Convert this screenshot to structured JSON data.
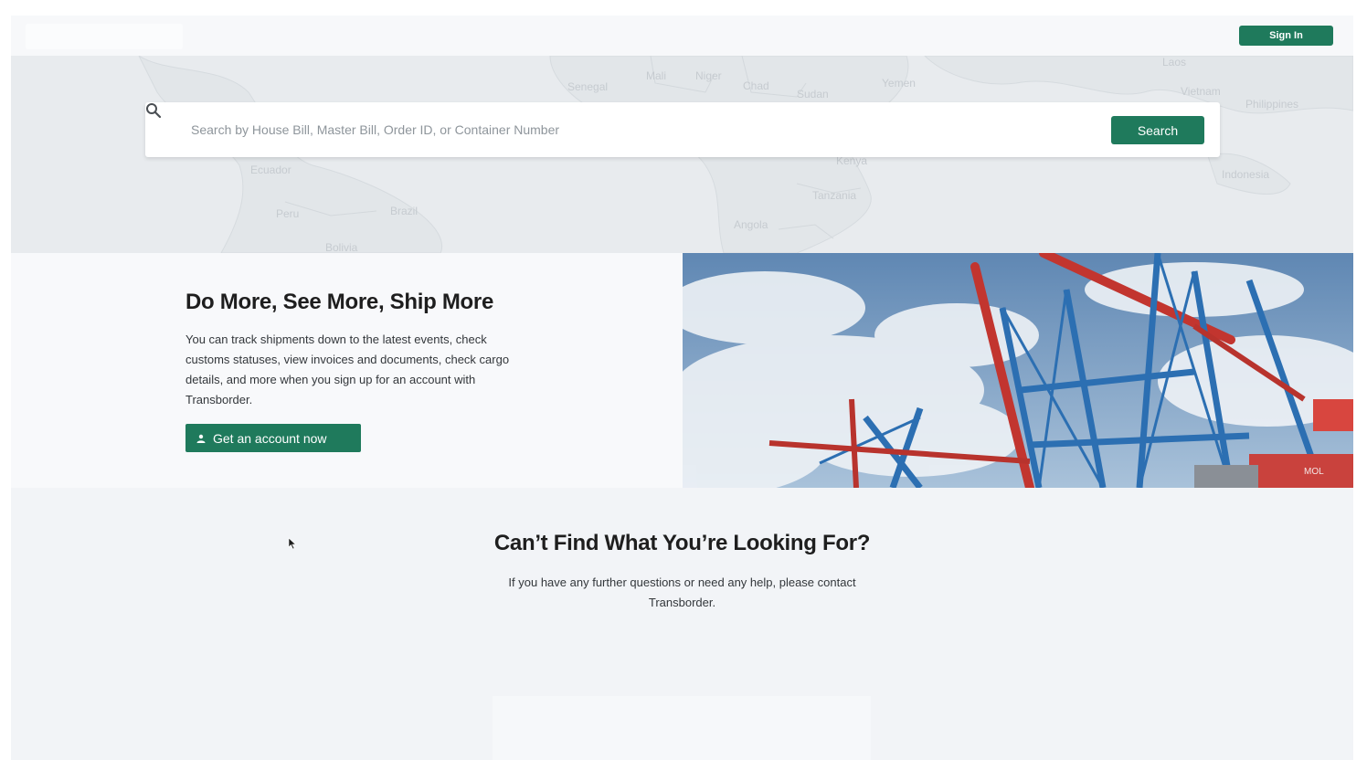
{
  "header": {
    "signin_label": "Sign In"
  },
  "map": {
    "labels": {
      "senegal": "Senegal",
      "mali": "Mali",
      "niger": "Niger",
      "chad": "Chad",
      "sudan": "Sudan",
      "yemen": "Yemen",
      "laos": "Laos",
      "vietnam": "Vietnam",
      "philippines": "Philippines",
      "ecuador": "Ecuador",
      "peru": "Peru",
      "brazil": "Brazil",
      "bolivia": "Bolivia",
      "kenya": "Kenya",
      "tanzania": "Tanzania",
      "angola": "Angola",
      "indonesia": "Indonesia"
    }
  },
  "search": {
    "placeholder": "Search by House Bill, Master Bill, Order ID, or Container Number",
    "button_label": "Search"
  },
  "promo": {
    "title": "Do More, See More, Ship More",
    "body": "You can track shipments down to the latest events, check customs statuses, view invoices and documents, check cargo details, and more when you sign up for an account with Transborder.",
    "cta_label": "Get an account now",
    "photo_text": "MOL"
  },
  "contact": {
    "title": "Can’t Find What You’re Looking For?",
    "body": "If you have any further questions or need any help, please contact Transborder."
  },
  "colors": {
    "brand_green": "#1f7a5c",
    "page_bg": "#f7f8fa"
  }
}
